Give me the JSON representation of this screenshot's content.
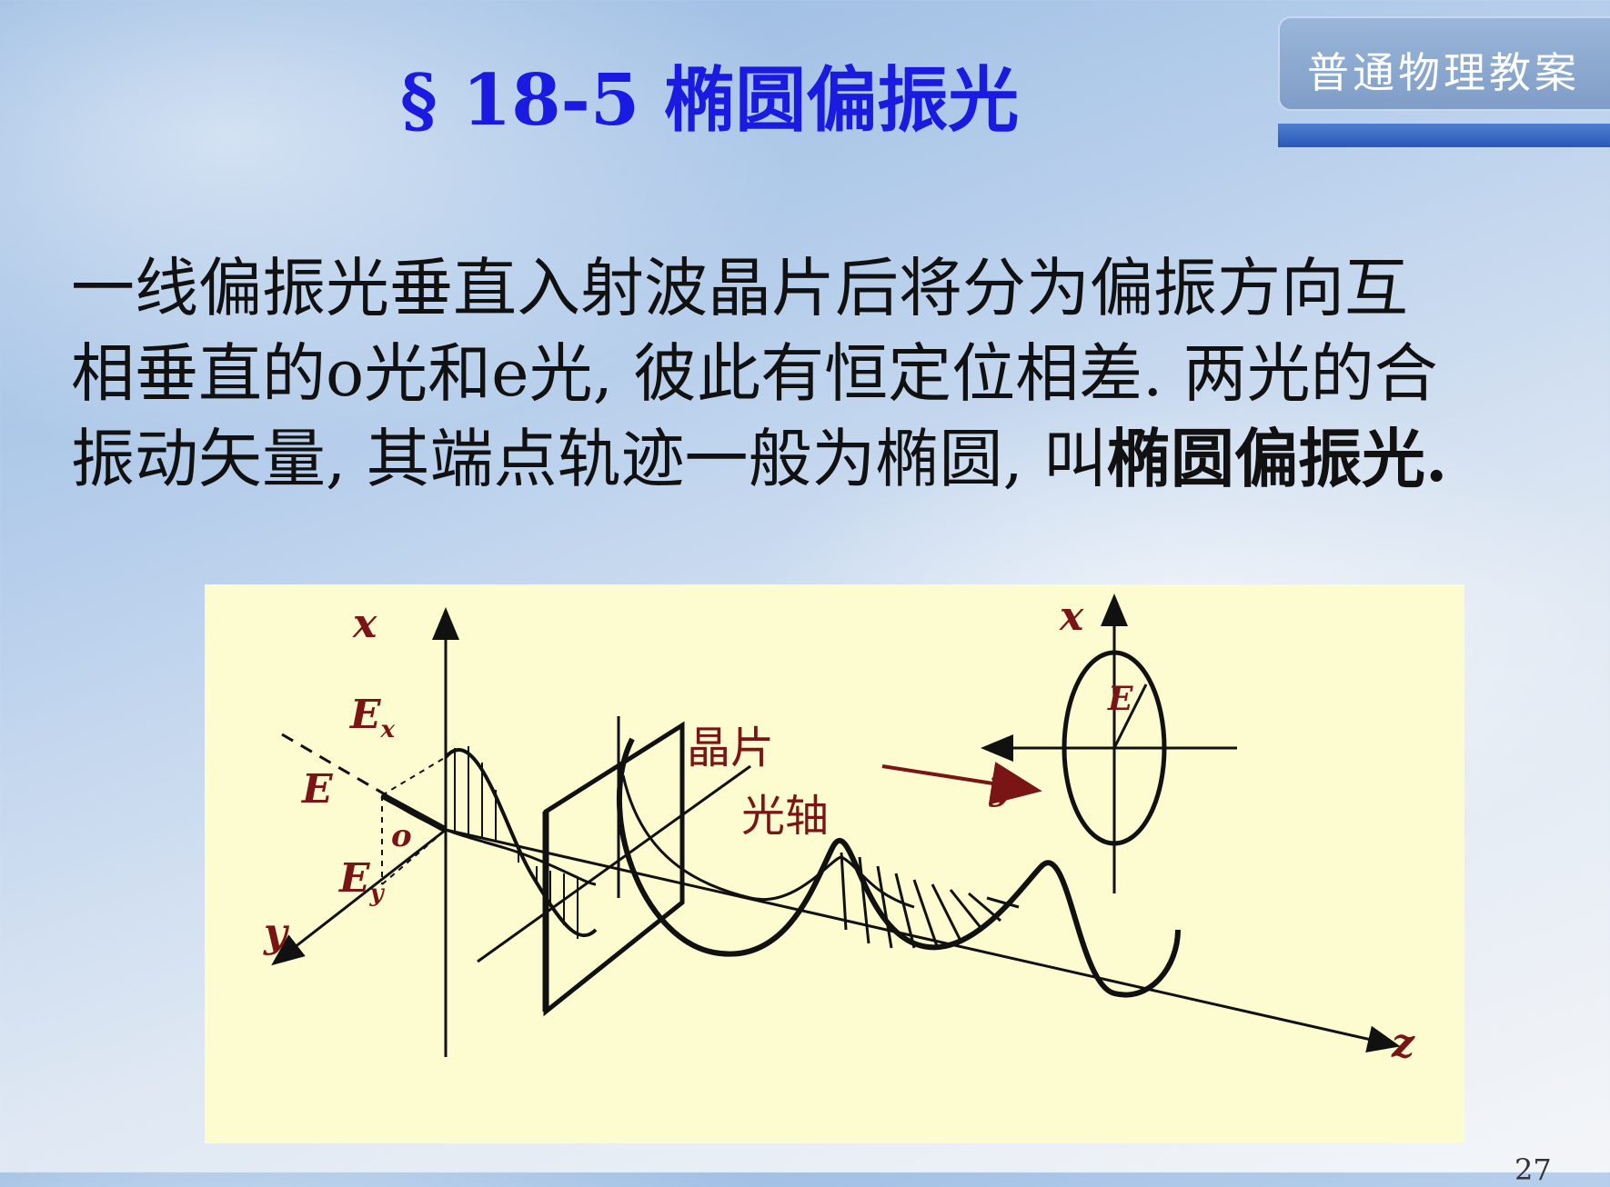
{
  "header": {
    "brand_label": "普通物理教案",
    "title": "§ 18-5   椭圆偏振光"
  },
  "body": {
    "line1": "一线偏振光垂直入射波晶片后将分为偏振方向互",
    "line2": "相垂直的o光和e光, 彼此有恒定位相差. 两光的合",
    "line3_normal": "振动矢量, 其端点轨迹一般为椭圆, 叫",
    "line3_bold": "椭圆偏振光."
  },
  "figure": {
    "labels": {
      "x_left": "x",
      "ex": "E",
      "ex_sub": "x",
      "e_left": "E",
      "o": "o",
      "ey": "E",
      "ey_sub": "y",
      "y_left": "y",
      "crystal": "晶片",
      "optic_axis": "光轴",
      "x_right": "x",
      "e_right": "E",
      "y_right": "y",
      "z": "z"
    },
    "colors": {
      "label": "#7a1515",
      "background": "#fdfbd0"
    }
  },
  "page_number": "27"
}
